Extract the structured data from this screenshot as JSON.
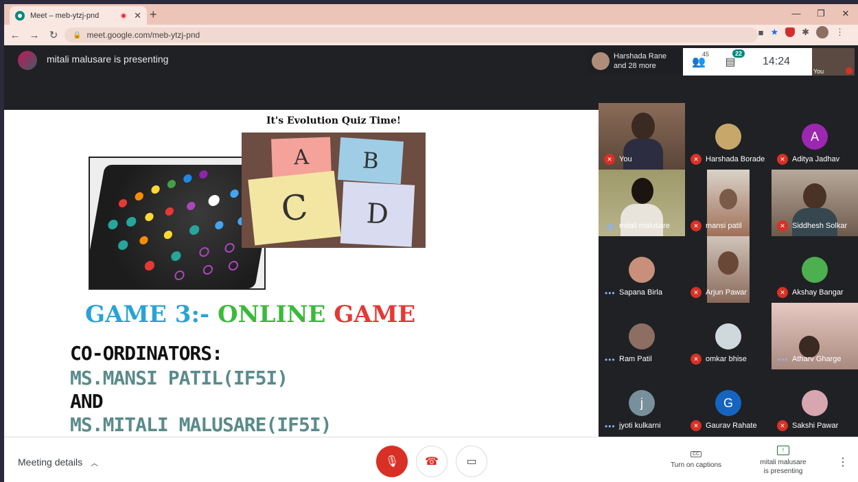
{
  "browser": {
    "tab_title": "Meet – meb-ytzj-pnd",
    "tab_close": "✕",
    "new_tab": "+",
    "url": "meet.google.com/meb-ytzj-pnd"
  },
  "meet": {
    "presenting_banner": "mitali malusare is presenting",
    "chip_line1": "Harshada Rane",
    "chip_line2": "and 28 more",
    "people_count": "45",
    "chat_count": "22",
    "time": "14:24",
    "self_label": "You"
  },
  "slide": {
    "quiz_title": "It's Evolution Quiz Time!",
    "cards": [
      "A",
      "B",
      "C",
      "D"
    ],
    "game_part1": "GAME 3:-",
    "game_part2": "ONLINE",
    "game_part3": "GAME",
    "coord_line1": "CO-ORDINATORS:",
    "coord_line2": "MS.MANSI PATIL(IF5I)",
    "coord_line3": "AND",
    "coord_line4": "MS.MITALI MALUSARE(IF5I)"
  },
  "participants": [
    {
      "name": "You",
      "state": "muted"
    },
    {
      "name": "Harshada Borade",
      "state": "muted"
    },
    {
      "name": "Aditya Jadhav",
      "state": "muted",
      "initial": "A",
      "color": "#9c27b0"
    },
    {
      "name": "mitali malusare",
      "state": "speaking"
    },
    {
      "name": "mansi patil",
      "state": "muted"
    },
    {
      "name": "Siddhesh Solkar",
      "state": "muted"
    },
    {
      "name": "Sapana Birla",
      "state": "active"
    },
    {
      "name": "Arjun Pawar",
      "state": "muted"
    },
    {
      "name": "Akshay Bangar",
      "state": "muted"
    },
    {
      "name": "Ram Patil",
      "state": "active"
    },
    {
      "name": "omkar bhise",
      "state": "muted"
    },
    {
      "name": "Atharv Gharge",
      "state": "active"
    },
    {
      "name": "jyoti kulkarni",
      "state": "active",
      "initial": "j",
      "color": "#78909c"
    },
    {
      "name": "Gaurav Rahate",
      "state": "muted",
      "initial": "G",
      "color": "#1565c0"
    },
    {
      "name": "Sakshi Pawar",
      "state": "muted"
    }
  ],
  "bottom": {
    "meeting_details": "Meeting details",
    "captions": "Turn on captions",
    "presenting_line1": "mitali malusare",
    "presenting_line2": "is presenting"
  },
  "colors": {
    "mute_red": "#d93025",
    "tab_strip": "#ecc5b8",
    "meet_dark": "#202124"
  }
}
